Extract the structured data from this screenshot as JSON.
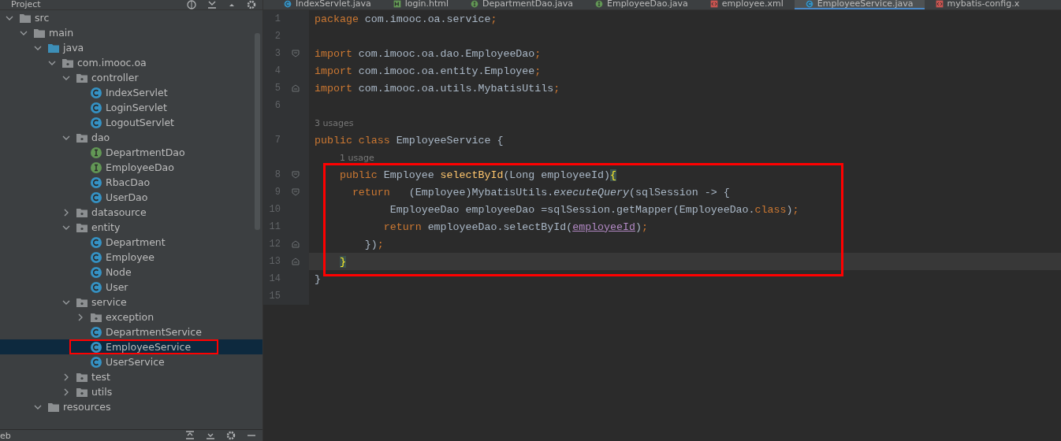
{
  "project_panel": {
    "title": "Project",
    "tree": [
      {
        "label": "src",
        "kind": "folder",
        "expanded": true,
        "selected": false,
        "boxed": false,
        "children": [
          {
            "label": "main",
            "kind": "folder",
            "expanded": true,
            "selected": false,
            "boxed": false,
            "children": [
              {
                "label": "java",
                "kind": "source",
                "expanded": true,
                "selected": false,
                "boxed": false,
                "children": [
                  {
                    "label": "com.imooc.oa",
                    "kind": "package",
                    "expanded": true,
                    "selected": false,
                    "boxed": false,
                    "children": [
                      {
                        "label": "controller",
                        "kind": "package",
                        "expanded": true,
                        "selected": false,
                        "boxed": false,
                        "children": [
                          {
                            "label": "IndexServlet",
                            "kind": "class",
                            "selected": false,
                            "boxed": false
                          },
                          {
                            "label": "LoginServlet",
                            "kind": "class",
                            "selected": false,
                            "boxed": false
                          },
                          {
                            "label": "LogoutServlet",
                            "kind": "class",
                            "selected": false,
                            "boxed": false
                          }
                        ]
                      },
                      {
                        "label": "dao",
                        "kind": "package",
                        "expanded": true,
                        "selected": false,
                        "boxed": false,
                        "children": [
                          {
                            "label": "DepartmentDao",
                            "kind": "interface",
                            "selected": false,
                            "boxed": false
                          },
                          {
                            "label": "EmployeeDao",
                            "kind": "interface",
                            "selected": false,
                            "boxed": false
                          },
                          {
                            "label": "RbacDao",
                            "kind": "class",
                            "selected": false,
                            "boxed": false
                          },
                          {
                            "label": "UserDao",
                            "kind": "class",
                            "selected": false,
                            "boxed": false
                          }
                        ]
                      },
                      {
                        "label": "datasource",
                        "kind": "package",
                        "expanded": false,
                        "selected": false,
                        "boxed": false
                      },
                      {
                        "label": "entity",
                        "kind": "package",
                        "expanded": true,
                        "selected": false,
                        "boxed": false,
                        "children": [
                          {
                            "label": "Department",
                            "kind": "class",
                            "selected": false,
                            "boxed": false
                          },
                          {
                            "label": "Employee",
                            "kind": "class",
                            "selected": false,
                            "boxed": false
                          },
                          {
                            "label": "Node",
                            "kind": "class",
                            "selected": false,
                            "boxed": false
                          },
                          {
                            "label": "User",
                            "kind": "class",
                            "selected": false,
                            "boxed": false
                          }
                        ]
                      },
                      {
                        "label": "service",
                        "kind": "package",
                        "expanded": true,
                        "selected": false,
                        "boxed": false,
                        "children": [
                          {
                            "label": "exception",
                            "kind": "package",
                            "expanded": false,
                            "selected": false,
                            "boxed": false
                          },
                          {
                            "label": "DepartmentService",
                            "kind": "class",
                            "selected": false,
                            "boxed": false
                          },
                          {
                            "label": "EmployeeService",
                            "kind": "class",
                            "selected": true,
                            "boxed": true
                          },
                          {
                            "label": "UserService",
                            "kind": "class",
                            "selected": false,
                            "boxed": false
                          }
                        ]
                      },
                      {
                        "label": "test",
                        "kind": "package",
                        "expanded": false,
                        "selected": false,
                        "boxed": false
                      },
                      {
                        "label": "utils",
                        "kind": "package",
                        "expanded": false,
                        "selected": false,
                        "boxed": false
                      }
                    ]
                  }
                ]
              },
              {
                "label": "resources",
                "kind": "folder",
                "expanded": true,
                "selected": false,
                "boxed": false
              }
            ]
          }
        ]
      }
    ],
    "bottom_label": "eb"
  },
  "editor": {
    "tabs": [
      {
        "label": "IndexServlet.java",
        "kind": "class",
        "selected": false
      },
      {
        "label": "login.html",
        "kind": "html",
        "selected": false
      },
      {
        "label": "DepartmentDao.java",
        "kind": "interface",
        "selected": false
      },
      {
        "label": "EmployeeDao.java",
        "kind": "interface",
        "selected": false
      },
      {
        "label": "employee.xml",
        "kind": "xml",
        "selected": false
      },
      {
        "label": "EmployeeService.java",
        "kind": "class",
        "selected": true
      },
      {
        "label": "mybatis-config.x",
        "kind": "xml",
        "selected": false
      }
    ],
    "blocks": [
      {
        "boxed": false,
        "lines": [
          {
            "kind": "code",
            "number": "1",
            "fold_start": false,
            "fold_end": false,
            "current": false,
            "brace_match": false,
            "tokens": [
              {
                "text": "package",
                "kind": "keyword"
              },
              {
                "text": " com.imooc.oa.service",
                "kind": "plain"
              },
              {
                "text": ";",
                "kind": "keyword"
              }
            ]
          },
          {
            "kind": "code",
            "number": "2",
            "fold_start": false,
            "fold_end": false,
            "current": false,
            "brace_match": false
          },
          {
            "kind": "code",
            "number": "3",
            "fold_start": true,
            "fold_end": false,
            "current": false,
            "brace_match": false,
            "tokens": [
              {
                "text": "import",
                "kind": "keyword"
              },
              {
                "text": " com.imooc.oa.dao.EmployeeDao",
                "kind": "plain"
              },
              {
                "text": ";",
                "kind": "keyword"
              }
            ]
          },
          {
            "kind": "code",
            "number": "4",
            "fold_start": false,
            "fold_end": false,
            "current": false,
            "brace_match": false,
            "tokens": [
              {
                "text": "import",
                "kind": "keyword"
              },
              {
                "text": " com.imooc.oa.entity.Employee",
                "kind": "plain"
              },
              {
                "text": ";",
                "kind": "keyword"
              }
            ]
          },
          {
            "kind": "code",
            "number": "5",
            "fold_start": false,
            "fold_end": true,
            "current": false,
            "brace_match": false,
            "tokens": [
              {
                "text": "import",
                "kind": "keyword"
              },
              {
                "text": " com.imooc.oa.utils.MybatisUtils",
                "kind": "plain"
              },
              {
                "text": ";",
                "kind": "keyword"
              }
            ]
          },
          {
            "kind": "code",
            "number": "6",
            "fold_start": false,
            "fold_end": false,
            "current": false,
            "brace_match": false
          },
          {
            "kind": "hint",
            "text": "3 usages"
          },
          {
            "kind": "code",
            "number": "7",
            "fold_start": false,
            "fold_end": false,
            "current": false,
            "brace_match": false,
            "tokens": [
              {
                "text": "public class",
                "kind": "keyword"
              },
              {
                "text": " EmployeeService {",
                "kind": "plain"
              }
            ]
          },
          {
            "kind": "hint",
            "text": "1 usage"
          }
        ]
      },
      {
        "boxed": true,
        "lines": [
          {
            "kind": "code",
            "number": "8",
            "fold_start": true,
            "fold_end": false,
            "current": false,
            "brace_match": true,
            "tokens": [
              {
                "text": "    public",
                "kind": "keyword"
              },
              {
                "text": " Employee ",
                "kind": "plain"
              },
              {
                "text": "selectById",
                "kind": "method"
              },
              {
                "text": "(Long employeeId){",
                "kind": "plain"
              }
            ]
          },
          {
            "kind": "code",
            "number": "9",
            "fold_start": true,
            "fold_end": false,
            "current": false,
            "brace_match": false,
            "tokens": [
              {
                "text": "      return",
                "kind": "keyword"
              },
              {
                "text": "   (Employee)MybatisUtils.",
                "kind": "plain"
              },
              {
                "text": "executeQuery",
                "kind": "static"
              },
              {
                "text": "(sqlSession -> {",
                "kind": "plain"
              }
            ]
          },
          {
            "kind": "code",
            "number": "10",
            "fold_start": false,
            "fold_end": false,
            "current": false,
            "brace_match": false,
            "tokens": [
              {
                "text": "            EmployeeDao employeeDao =sqlSession.getMapper(EmployeeDao.",
                "kind": "plain"
              },
              {
                "text": "class",
                "kind": "keyword"
              },
              {
                "text": ")",
                "kind": "plain"
              },
              {
                "text": ";",
                "kind": "keyword"
              }
            ]
          },
          {
            "kind": "code",
            "number": "11",
            "fold_start": false,
            "fold_end": false,
            "current": false,
            "brace_match": false,
            "tokens": [
              {
                "text": "           return",
                "kind": "keyword"
              },
              {
                "text": " employeeDao.selectById(",
                "kind": "plain"
              },
              {
                "text": "employeeId",
                "kind": "parameter"
              },
              {
                "text": ")",
                "kind": "plain"
              },
              {
                "text": ";",
                "kind": "keyword"
              }
            ]
          },
          {
            "kind": "code",
            "number": "12",
            "fold_start": false,
            "fold_end": true,
            "current": false,
            "brace_match": false,
            "tokens": [
              {
                "text": "        })",
                "kind": "plain"
              },
              {
                "text": ";",
                "kind": "keyword"
              }
            ]
          },
          {
            "kind": "code",
            "number": "13",
            "fold_start": false,
            "fold_end": true,
            "current": true,
            "brace_match": true,
            "tokens": [
              {
                "text": "    }",
                "kind": "plain"
              }
            ]
          }
        ]
      },
      {
        "boxed": false,
        "lines": [
          {
            "kind": "code",
            "number": "14",
            "fold_start": false,
            "fold_end": false,
            "current": false,
            "brace_match": false,
            "tokens": [
              {
                "text": "}",
                "kind": "plain"
              }
            ]
          },
          {
            "kind": "code",
            "number": "15",
            "fold_start": false,
            "fold_end": false,
            "current": false,
            "brace_match": false
          }
        ]
      }
    ]
  }
}
